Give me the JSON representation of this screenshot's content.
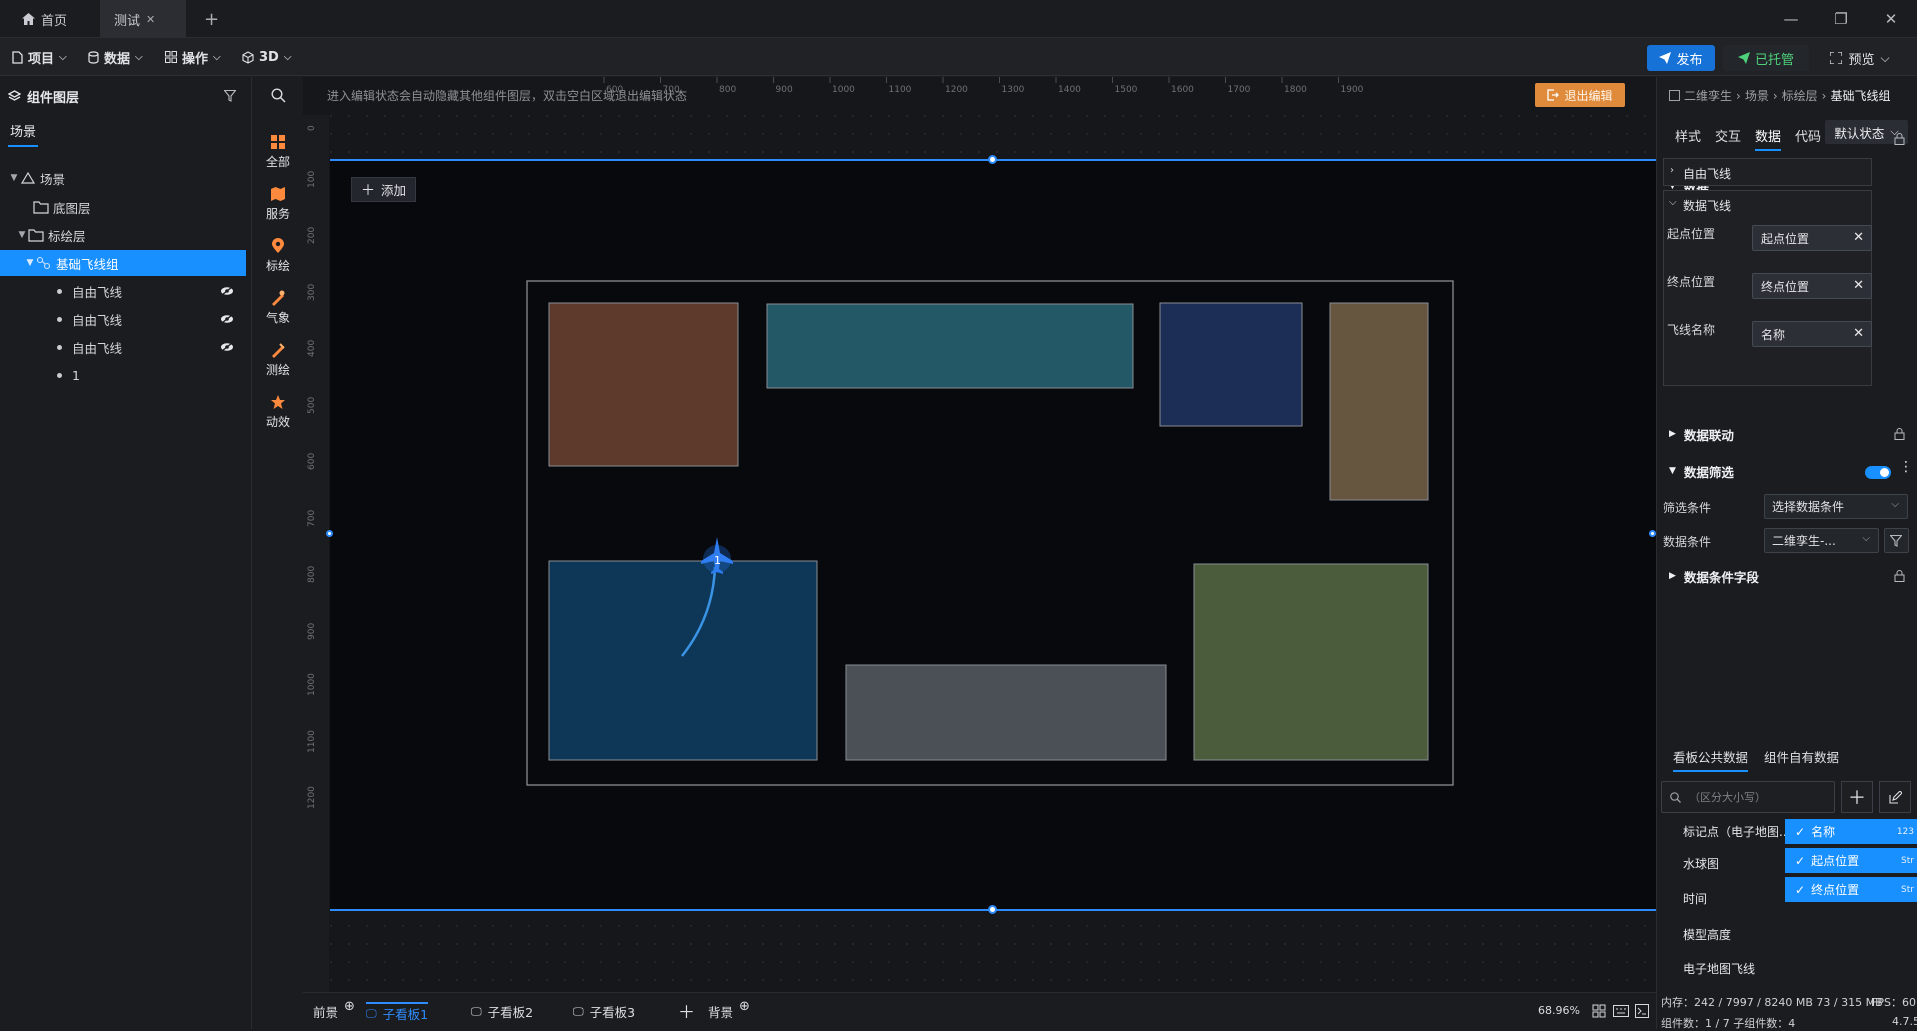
{
  "tabs": [
    {
      "label": "首页",
      "icon": "home-icon"
    },
    {
      "label": "测试",
      "icon": "close-icon"
    }
  ],
  "window_controls": {
    "minimize": "—",
    "restore": "❐",
    "close": "✕"
  },
  "menubar": {
    "items": [
      "项目",
      "数据",
      "操作",
      "3D"
    ],
    "publish": "发布",
    "hosted": "已托管",
    "preview": "预览"
  },
  "left_panel": {
    "title": "组件图层",
    "tab": "场景",
    "tree": [
      {
        "label": "场景",
        "level": 0,
        "type": "scene"
      },
      {
        "label": "底图层",
        "level": 1,
        "type": "folder"
      },
      {
        "label": "标绘层",
        "level": 1,
        "type": "folder"
      },
      {
        "label": "基础飞线组",
        "level": 2,
        "type": "group",
        "selected": true
      },
      {
        "label": "自由飞线",
        "level": 3,
        "type": "item"
      },
      {
        "label": "自由飞线",
        "level": 3,
        "type": "item"
      },
      {
        "label": "自由飞线",
        "level": 3,
        "type": "item"
      },
      {
        "label": "1",
        "level": 3,
        "type": "item"
      }
    ]
  },
  "icon_column": [
    {
      "label": "全部",
      "icon": "grid-icon"
    },
    {
      "label": "服务",
      "icon": "map-icon"
    },
    {
      "label": "标绘",
      "icon": "pin-icon"
    },
    {
      "label": "气象",
      "icon": "weather-icon"
    },
    {
      "label": "测绘",
      "icon": "survey-icon"
    },
    {
      "label": "动效",
      "icon": "effect-icon"
    }
  ],
  "canvas": {
    "hint": "进入编辑状态会自动隐藏其他组件图层，双击空白区域退出编辑状态",
    "exit_edit": "退出编辑",
    "add_button": "添加",
    "ruler_top": [
      "600",
      "700",
      "800",
      "900",
      "1000",
      "1100",
      "1200",
      "1300",
      "1400",
      "1500",
      "1600",
      "1700",
      "1800",
      "1900"
    ],
    "ruler_left": [
      "0",
      "100",
      "200",
      "300",
      "400",
      "500",
      "600",
      "700",
      "800",
      "900",
      "1000",
      "1100",
      "1200"
    ],
    "marker_label": "1",
    "colors": {
      "board": "#07090c",
      "selection": "#2f8cff",
      "plane": "#2f7df0"
    }
  },
  "bottom_bar": {
    "front": "前景",
    "sub1": "子看板1",
    "sub2": "子看板2",
    "sub3": "子看板3",
    "background": "背景",
    "zoom": "68.96%"
  },
  "right_panel": {
    "breadcrumb": [
      "二维孪生",
      "场景",
      "标绘层",
      "基础飞线组"
    ],
    "tabs": [
      "样式",
      "交互",
      "数据",
      "代码"
    ],
    "active_tab": "数据",
    "state": "默认状态",
    "sections": {
      "data": "数据",
      "free_line": "自由飞线",
      "data_line": "数据飞线",
      "start_label": "起点位置",
      "start_value": "起点位置",
      "end_label": "终点位置",
      "end_value": "终点位置",
      "name_label": "飞线名称",
      "name_value": "名称",
      "linkage": "数据联动",
      "filter": "数据筛选",
      "filter_cond_label": "筛选条件",
      "filter_cond_value": "选择数据条件",
      "data_cond_label": "数据条件",
      "data_cond_value": "二维孪生-...",
      "cond_fields": "数据条件字段"
    },
    "pub_tabs": [
      "看板公共数据",
      "组件自有数据"
    ],
    "search_placeholder": "（区分大小写）",
    "data_list": [
      "标记点（电子地图...",
      "水球图",
      "时间",
      "模型高度",
      "电子地图飞线"
    ],
    "checked_fields": [
      {
        "label": "名称",
        "type": "123"
      },
      {
        "label": "起点位置",
        "type": "Str"
      },
      {
        "label": "终点位置",
        "type": "Str"
      }
    ],
    "stats": {
      "memory": "内存：242 / 7997 / 8240 MB  73 / 315 MB",
      "fps": "FPS：60",
      "components": "组件数：1 / 7    子组件数：4",
      "version": "4.7.5"
    }
  }
}
